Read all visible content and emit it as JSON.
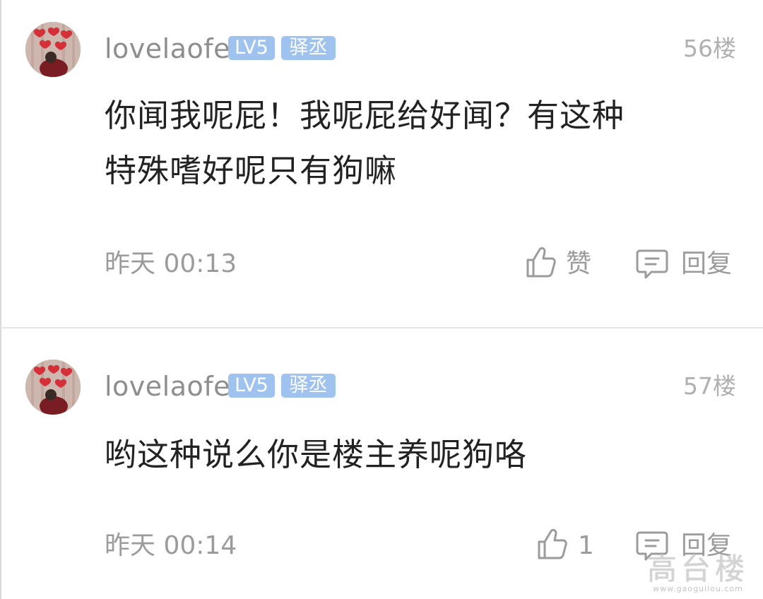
{
  "posts": [
    {
      "username": "lovelaofe",
      "level_badge": "LV5",
      "title_badge": "驿丞",
      "floor": "56楼",
      "content_lines": [
        "你闻我呢屁！我呢屁给好闻？有这种",
        "特殊嗜好呢只有狗嘛"
      ],
      "time": "昨天 00:13",
      "like_label": "赞",
      "reply_label": "回复"
    },
    {
      "username": "lovelaofe",
      "level_badge": "LV5",
      "title_badge": "驿丞",
      "floor": "57楼",
      "content_lines": [
        "哟这种说么你是楼主养呢狗咯"
      ],
      "time": "昨天 00:14",
      "like_label": "1",
      "reply_label": "回复"
    }
  ],
  "watermark": {
    "title": "高台楼",
    "url": "www.gaoguilou.com"
  },
  "colors": {
    "badge_bg": "#9fc3ee",
    "text_primary": "#222222",
    "text_secondary": "#9b9b9b",
    "divider": "#e6e6e6"
  },
  "icons": [
    "thumbs-up-icon",
    "comment-icon"
  ]
}
